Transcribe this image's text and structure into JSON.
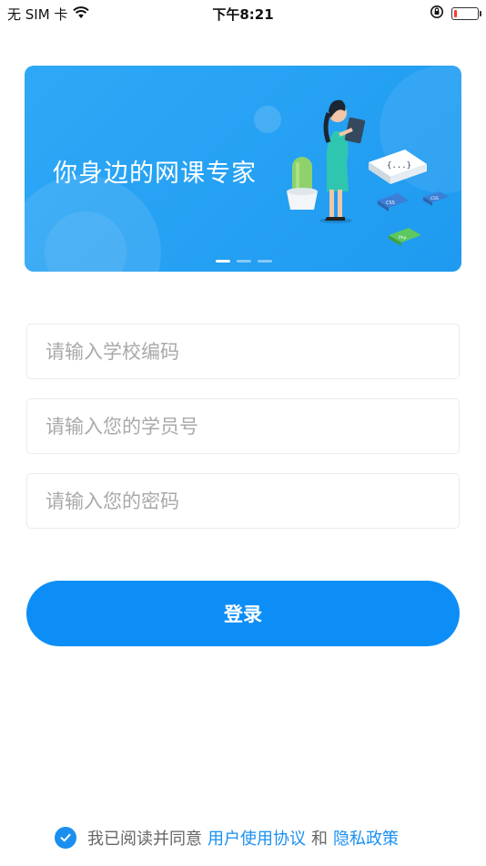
{
  "status_bar": {
    "carrier": "无 SIM 卡",
    "time": "下午8:21",
    "battery_level": 0.12,
    "icons": [
      "wifi-icon",
      "orientation-lock-icon",
      "battery-icon"
    ]
  },
  "banner": {
    "title": "你身边的网课专家",
    "page_count": 3,
    "active_page": 1,
    "illustration_labels": [
      "{...}",
      "CSS",
      "CSS",
      "Php"
    ]
  },
  "form": {
    "school_code_placeholder": "请输入学校编码",
    "student_id_placeholder": "请输入您的学员号",
    "password_placeholder": "请输入您的密码"
  },
  "login_label": "登录",
  "agreement": {
    "checked": true,
    "prefix": "我已阅读并同意",
    "terms": "用户使用协议",
    "and": "和",
    "privacy": "隐私政策"
  },
  "colors": {
    "primary": "#0d8ef7",
    "banner": "#2ea8f6",
    "link": "#1a8ff0",
    "battery_low": "#ff3b30"
  }
}
